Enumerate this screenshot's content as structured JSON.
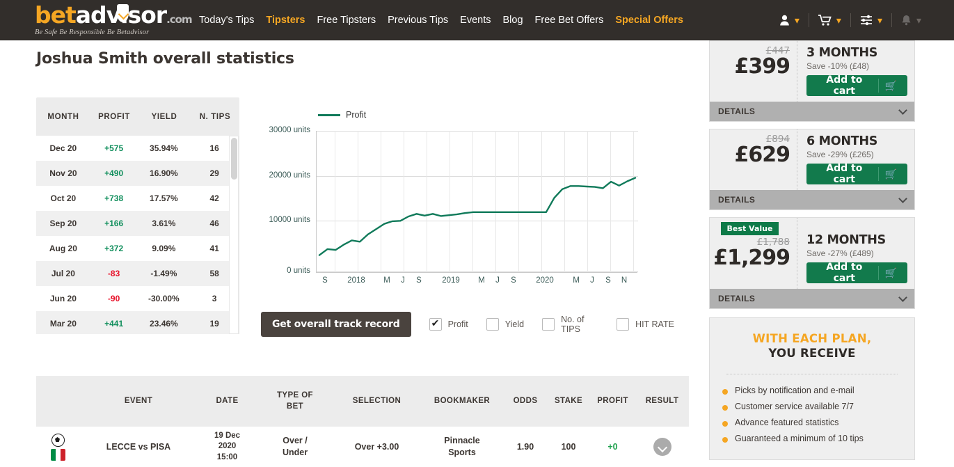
{
  "header": {
    "logo": {
      "bet": "bet",
      "advisor": "advisor",
      "dotcom": ".com",
      "tagline": "Be Safe Be Responsible Be Betadvisor"
    },
    "nav": [
      {
        "label": "Today's Tips",
        "highlight": false
      },
      {
        "label": "Tipsters",
        "highlight": true
      },
      {
        "label": "Free Tipsters",
        "highlight": false
      },
      {
        "label": "Previous Tips",
        "highlight": false
      },
      {
        "label": "Events",
        "highlight": false
      },
      {
        "label": "Blog",
        "highlight": false
      },
      {
        "label": "Free Bet Offers",
        "highlight": false
      },
      {
        "label": "Special Offers",
        "highlight": true
      }
    ],
    "icons": [
      "user-icon",
      "cart-icon",
      "settings-sliders-icon",
      "bell-icon"
    ]
  },
  "page": {
    "title": "Joshua Smith overall statistics"
  },
  "stats_table": {
    "columns": [
      "MONTH",
      "PROFIT",
      "YIELD",
      "N. TIPS"
    ],
    "rows": [
      {
        "month": "Dec 20",
        "profit": "+575",
        "sign": "pos",
        "yield": "35.94%",
        "tips": "16"
      },
      {
        "month": "Nov 20",
        "profit": "+490",
        "sign": "pos",
        "yield": "16.90%",
        "tips": "29"
      },
      {
        "month": "Oct 20",
        "profit": "+738",
        "sign": "pos",
        "yield": "17.57%",
        "tips": "42"
      },
      {
        "month": "Sep 20",
        "profit": "+166",
        "sign": "pos",
        "yield": "3.61%",
        "tips": "46"
      },
      {
        "month": "Aug 20",
        "profit": "+372",
        "sign": "pos",
        "yield": "9.09%",
        "tips": "41"
      },
      {
        "month": "Jul 20",
        "profit": "-83",
        "sign": "neg",
        "yield": "-1.49%",
        "tips": "58"
      },
      {
        "month": "Jun 20",
        "profit": "-90",
        "sign": "neg",
        "yield": "-30.00%",
        "tips": "3"
      },
      {
        "month": "Mar 20",
        "profit": "+441",
        "sign": "pos",
        "yield": "23.46%",
        "tips": "19"
      }
    ]
  },
  "chart_data": {
    "type": "line",
    "title": "",
    "legend": [
      "Profit"
    ],
    "legend_position": "top-left",
    "xlabel": "",
    "ylabel": "units",
    "ytick_labels": [
      "0 units",
      "10000 units",
      "20000 units",
      "30000 units"
    ],
    "ytick_values": [
      0,
      10000,
      20000,
      30000
    ],
    "ylim": [
      0,
      32500
    ],
    "grid": true,
    "xtick_labels": [
      "S",
      "2018",
      "M",
      "J",
      "S",
      "2019",
      "M",
      "J",
      "S",
      "2020",
      "M",
      "J",
      "S",
      "N"
    ],
    "series": [
      {
        "name": "Profit",
        "color": "#107a5a",
        "x": [
          "2017-09",
          "2017-10",
          "2017-11",
          "2017-12",
          "2018-01",
          "2018-02",
          "2018-03",
          "2018-04",
          "2018-05",
          "2018-06",
          "2018-07",
          "2018-08",
          "2018-09",
          "2018-10",
          "2018-11",
          "2018-12",
          "2019-01",
          "2019-02",
          "2019-03",
          "2019-04",
          "2019-05",
          "2019-06",
          "2019-07",
          "2019-08",
          "2019-09",
          "2019-10",
          "2019-11",
          "2019-12",
          "2020-01",
          "2020-02",
          "2020-03",
          "2020-04",
          "2020-05",
          "2020-06",
          "2020-07",
          "2020-08",
          "2020-09",
          "2020-10",
          "2020-11",
          "2020-12"
        ],
        "values": [
          3900,
          5300,
          5100,
          6300,
          7300,
          7000,
          8700,
          9900,
          11100,
          11700,
          11800,
          12800,
          13400,
          13000,
          13400,
          12900,
          13100,
          13300,
          13600,
          13800,
          13800,
          13800,
          13800,
          13800,
          13800,
          13800,
          13800,
          13800,
          13800,
          17100,
          19100,
          19800,
          19800,
          19700,
          19600,
          19300,
          20800,
          19900,
          20900,
          21700
        ]
      }
    ]
  },
  "chart_controls": {
    "button": "Get overall track record",
    "checkboxes": [
      {
        "label": "Profit",
        "checked": true
      },
      {
        "label": "Yield",
        "checked": false
      },
      {
        "label": "No. of TIPS",
        "checked": false
      },
      {
        "label": "HIT RATE",
        "checked": false
      }
    ]
  },
  "bets_table": {
    "columns": [
      "",
      "EVENT",
      "DATE",
      "TYPE OF BET",
      "SELECTION",
      "BOOKMAKER",
      "ODDS",
      "STAKE",
      "PROFIT",
      "RESULT"
    ],
    "rows": [
      {
        "sport_icon": "football-icon",
        "country_flag": "italy-flag-icon",
        "event": "LECCE vs PISA",
        "date": "19 Dec 2020 15:00",
        "type_of_bet": "Over / Under",
        "selection": "Over +3.00",
        "bookmaker": "Pinnacle Sports",
        "odds": "1.90",
        "stake": "100",
        "profit": "+0",
        "result_icon": "chevron-down-circle-icon"
      }
    ]
  },
  "sidebar": {
    "plans": [
      {
        "old_price": "£447",
        "price": "£399",
        "months": "3 MONTHS",
        "save": "Save -10% (£48)",
        "add_label": "Add to cart",
        "details_label": "DETAILS",
        "badge": null
      },
      {
        "old_price": "£894",
        "price": "£629",
        "months": "6 MONTHS",
        "save": "Save -29% (£265)",
        "add_label": "Add to cart",
        "details_label": "DETAILS",
        "badge": null
      },
      {
        "old_price": "£1,788",
        "price": "£1,299",
        "months": "12 MONTHS",
        "save": "Save -27% (£489)",
        "add_label": "Add to cart",
        "details_label": "DETAILS",
        "badge": "Best Value"
      }
    ],
    "plan_info": {
      "title_line1": "WITH EACH PLAN,",
      "title_line2": "YOU RECEIVE",
      "items": [
        "Picks by notification and e-mail",
        "Customer service available 7/7",
        "Advance featured statistics",
        "Guaranteed a minimum of 10 tips"
      ]
    }
  },
  "colors": {
    "brand_orange": "#f5a623",
    "header_dark": "#322e2b",
    "green": "#127a4c",
    "profit_green": "#128f5d",
    "loss_red": "#e8122a",
    "chart_line": "#107a5a"
  }
}
